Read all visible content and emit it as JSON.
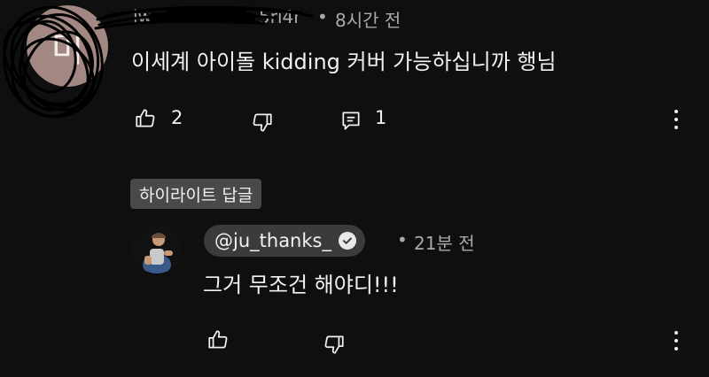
{
  "comment1": {
    "avatar_letter": "미",
    "author_visible": "iwc",
    "author_tail": "5ri4r",
    "time": "8시간 전",
    "text": "이세계 아이돌 kidding 커버 가능하십니까 행님",
    "like_count": "2",
    "reply_count": "1"
  },
  "reply": {
    "highlight_label": "하이라이트 답글",
    "author": "@ju_thanks_",
    "time": "21분 전",
    "text": "그거 무조건 해야디!!!"
  },
  "icons": {
    "like": "thumbs-up-icon",
    "dislike": "thumbs-down-icon",
    "reply": "comment-icon",
    "more": "more-vert-icon",
    "verified": "verified-check-icon"
  },
  "colors": {
    "background": "#0f0f0f",
    "text": "#f1f1f1",
    "meta": "#aaaaaa",
    "badge_bg": "#494949",
    "chip_bg": "#3b3b3b",
    "avatar1_bg": "#a38782"
  }
}
